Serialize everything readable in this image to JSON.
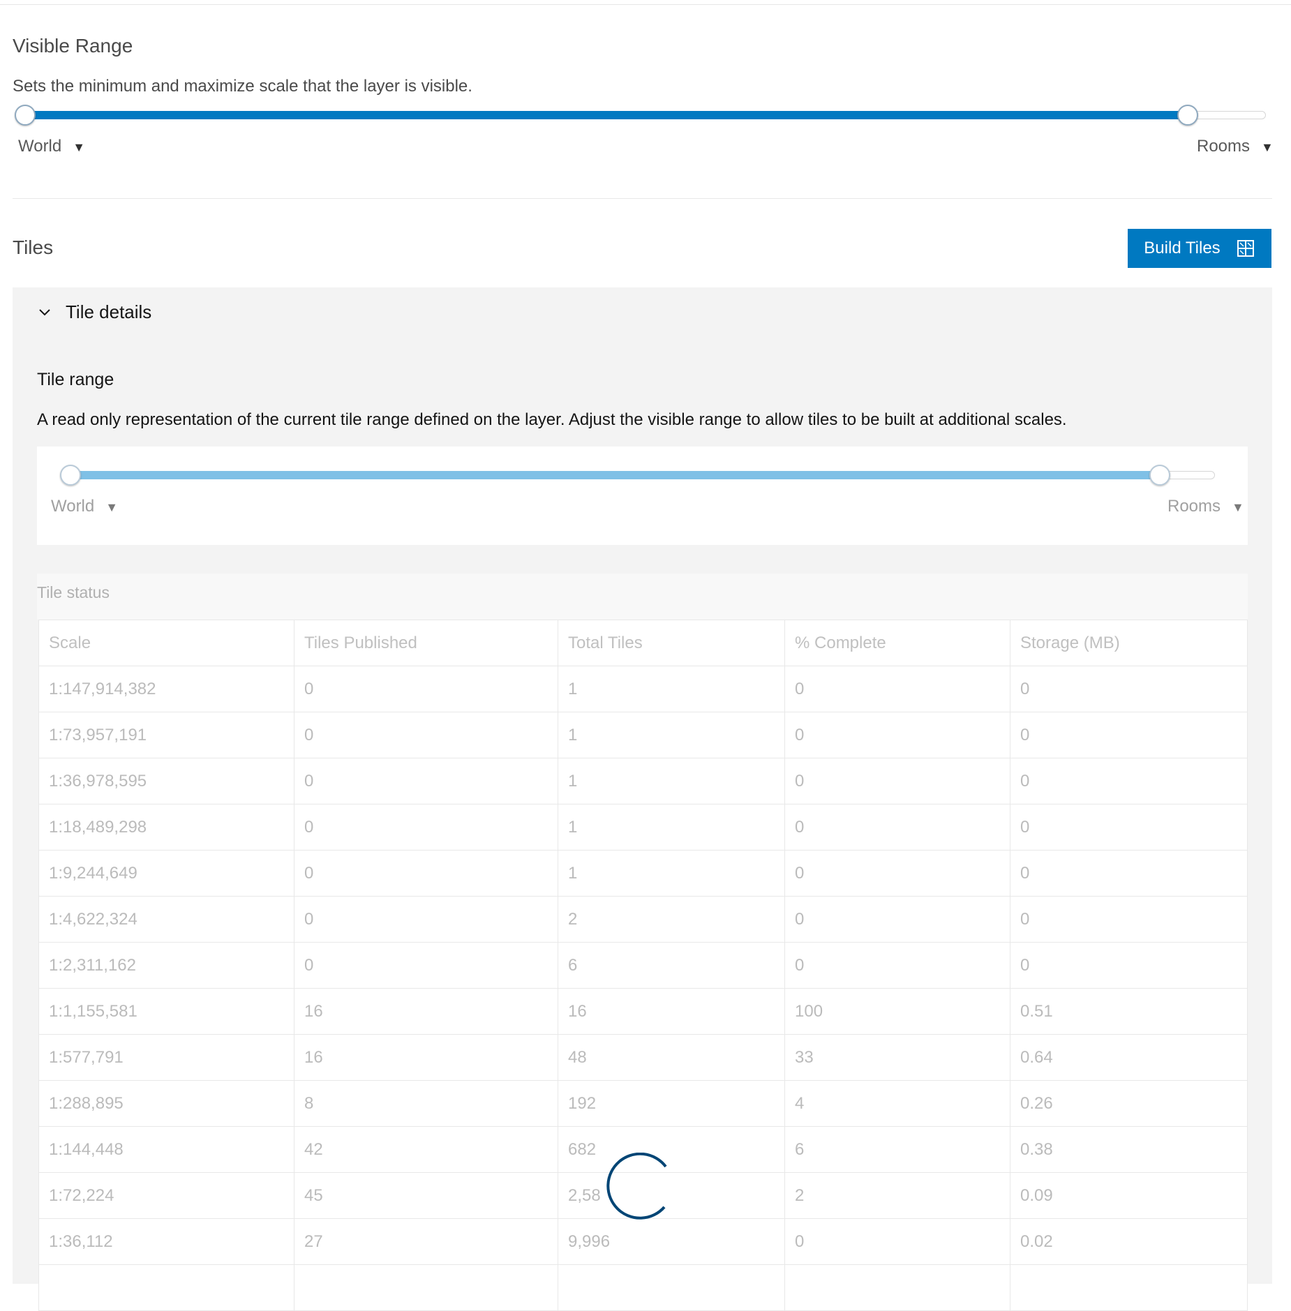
{
  "visible_range": {
    "title": "Visible Range",
    "description": "Sets the minimum and maximize scale that the layer is visible.",
    "min_scale": "World",
    "max_scale": "Rooms",
    "selected_min_fraction": 0.0,
    "selected_max_fraction": 0.93
  },
  "tiles": {
    "title": "Tiles",
    "build_button": "Build Tiles"
  },
  "tile_details": {
    "header": "Tile details",
    "expanded": true,
    "range_title": "Tile range",
    "range_description": "A read only representation of the current tile range defined on the layer. Adjust the visible range to allow tiles to be built at additional scales.",
    "min_scale": "World",
    "max_scale": "Rooms",
    "selected_min_fraction": 0.0,
    "selected_max_fraction": 0.94,
    "status_title": "Tile status",
    "columns": [
      "Scale",
      "Tiles Published",
      "Total Tiles",
      "% Complete",
      "Storage (MB)"
    ],
    "rows": [
      [
        "1:147,914,382",
        "0",
        "1",
        "0",
        "0"
      ],
      [
        "1:73,957,191",
        "0",
        "1",
        "0",
        "0"
      ],
      [
        "1:36,978,595",
        "0",
        "1",
        "0",
        "0"
      ],
      [
        "1:18,489,298",
        "0",
        "1",
        "0",
        "0"
      ],
      [
        "1:9,244,649",
        "0",
        "1",
        "0",
        "0"
      ],
      [
        "1:4,622,324",
        "0",
        "2",
        "0",
        "0"
      ],
      [
        "1:2,311,162",
        "0",
        "6",
        "0",
        "0"
      ],
      [
        "1:1,155,581",
        "16",
        "16",
        "100",
        "0.51"
      ],
      [
        "1:577,791",
        "16",
        "48",
        "33",
        "0.64"
      ],
      [
        "1:288,895",
        "8",
        "192",
        "4",
        "0.26"
      ],
      [
        "1:144,448",
        "42",
        "682",
        "6",
        "0.38"
      ],
      [
        "1:72,224",
        "45",
        "2,58",
        "2",
        "0.09"
      ],
      [
        "1:36,112",
        "27",
        "9,996",
        "0",
        "0.02"
      ],
      [
        "",
        "",
        "",
        "",
        ""
      ]
    ]
  },
  "colors": {
    "accent": "#0079c1",
    "accent_light": "#7fc0e6",
    "spinner": "#004575"
  }
}
